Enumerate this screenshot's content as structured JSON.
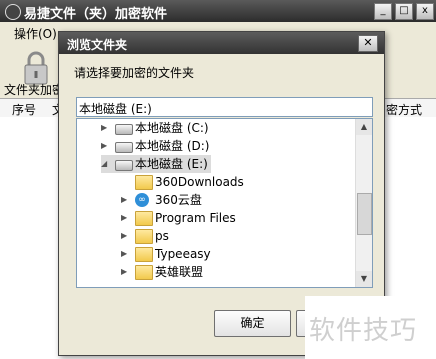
{
  "app": {
    "title": "易捷文件（夹）加密软件",
    "min_label": "_",
    "max_label": "□",
    "close_label": "x",
    "menu": [
      "操作(O)"
    ],
    "toolbar_label": "文件夹加密",
    "columns": [
      "序号",
      "文",
      "密方式"
    ]
  },
  "dialog": {
    "title": "浏览文件夹",
    "close_label": "✕",
    "prompt": "请选择要加密的文件夹",
    "path_value": "本地磁盘 (E:)",
    "tree": [
      {
        "arrow": "▶",
        "icon": "drive-icon",
        "label": "本地磁盘 (C:)",
        "level": 1
      },
      {
        "arrow": "▶",
        "icon": "drive-icon",
        "label": "本地磁盘 (D:)",
        "level": 1
      },
      {
        "arrow": "◢",
        "icon": "drive-icon",
        "label": "本地磁盘 (E:)",
        "level": 1,
        "selected": true
      },
      {
        "arrow": "",
        "icon": "folder-icon",
        "label": "360Downloads",
        "level": 2
      },
      {
        "arrow": "▶",
        "icon": "cloud-icon",
        "label": "360云盘",
        "level": 2
      },
      {
        "arrow": "▶",
        "icon": "folder-icon",
        "label": "Program Files",
        "level": 2
      },
      {
        "arrow": "▶",
        "icon": "folder-icon",
        "label": "ps",
        "level": 2
      },
      {
        "arrow": "▶",
        "icon": "folder-icon",
        "label": "Typeeasy",
        "level": 2
      },
      {
        "arrow": "▶",
        "icon": "folder-icon",
        "label": "英雄联盟",
        "level": 2
      }
    ],
    "ok_label": "确定"
  },
  "watermark": "软件技巧",
  "colors": {
    "titlebar": "#333333",
    "window_bg": "#ece9d8",
    "input_border": "#7f9db9",
    "folder": "#f2c94c"
  }
}
